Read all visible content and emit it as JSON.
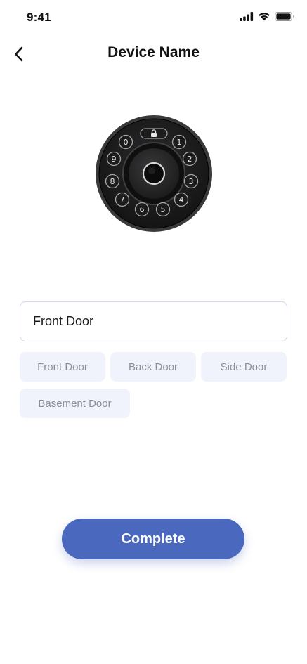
{
  "status_bar": {
    "time": "9:41",
    "icons": [
      "cellular-signal-icon",
      "wifi-icon",
      "battery-icon"
    ]
  },
  "header": {
    "back_icon": "chevron-left-icon",
    "title": "Device Name"
  },
  "device": {
    "keypad_digits": [
      "0",
      "1",
      "2",
      "3",
      "4",
      "5",
      "6",
      "7",
      "8",
      "9"
    ]
  },
  "name_field": {
    "value": "Front Door"
  },
  "suggestions": [
    {
      "label": "Front Door"
    },
    {
      "label": "Back Door"
    },
    {
      "label": "Side Door"
    },
    {
      "label": "Basement Door"
    }
  ],
  "actions": {
    "complete_label": "Complete"
  },
  "colors": {
    "accent": "#4a68bd",
    "chip_bg": "#f0f3fb",
    "chip_text": "#8a8f99",
    "input_border": "#cfd6e4"
  }
}
